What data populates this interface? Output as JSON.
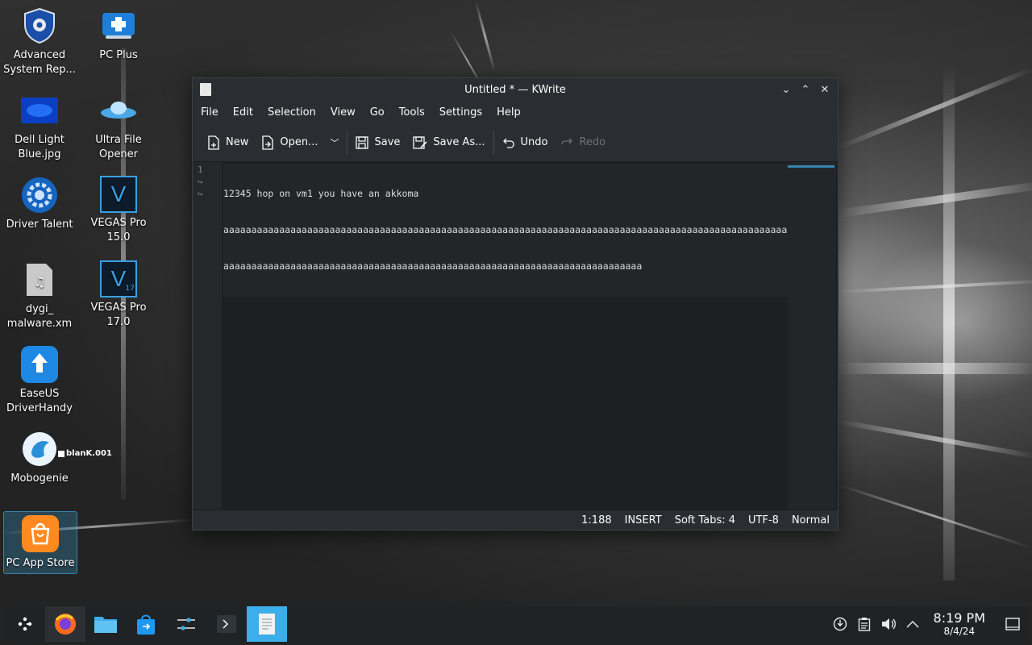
{
  "desktop": {
    "icons": [
      {
        "label": "Advanced System Rep..."
      },
      {
        "label": "PC Plus"
      },
      {
        "label": "Dell Light Blue.jpg"
      },
      {
        "label": "Ultra File Opener"
      },
      {
        "label": "Driver Talent"
      },
      {
        "label": "VEGAS Pro 15.0"
      },
      {
        "label": "dygi_ malware.xm"
      },
      {
        "label": "VEGAS Pro 17.0"
      },
      {
        "label": "EaseUS DriverHandy"
      },
      {
        "label": "Mobogenie"
      },
      {
        "label": "PC App Store"
      }
    ],
    "mobogenie_overlay": "blanK.001",
    "vegas_letter": "V",
    "vegas17_badge": "17"
  },
  "window": {
    "title": "Untitled * — KWrite",
    "menu": [
      "File",
      "Edit",
      "Selection",
      "View",
      "Go",
      "Tools",
      "Settings",
      "Help"
    ],
    "toolbar": {
      "new": "New",
      "open": "Open...",
      "save": "Save",
      "save_as": "Save As...",
      "undo": "Undo",
      "redo": "Redo"
    },
    "gutter": [
      "1",
      "↪",
      "↪"
    ],
    "lines": [
      "12345 hop on vm1 you have an akkoma",
      "aaaaaaaaaaaaaaaaaaaaaaaaaaaaaaaaaaaaaaaaaaaaaaaaaaaaaaaaaaaaaaaaaaaaaaaaaaaaaaaaaaaaaaaaaaaaaaaaaaaaaa",
      "aaaaaaaaaaaaaaaaaaaaaaaaaaaaaaaaaaaaaaaaaaaaaaaaaaaaaaaaaaaaaaaaaaaaaaaaaaa"
    ],
    "status": {
      "cursor": "1:188",
      "mode": "INSERT",
      "tabs": "Soft Tabs: 4",
      "encoding": "UTF-8",
      "input_mode": "Normal"
    }
  },
  "taskbar": {
    "time": "8:19 PM",
    "date": "8/4/24"
  },
  "colors": {
    "accent": "#3daee9",
    "window_bg": "#202326",
    "editor_bg": "#1d2023"
  }
}
